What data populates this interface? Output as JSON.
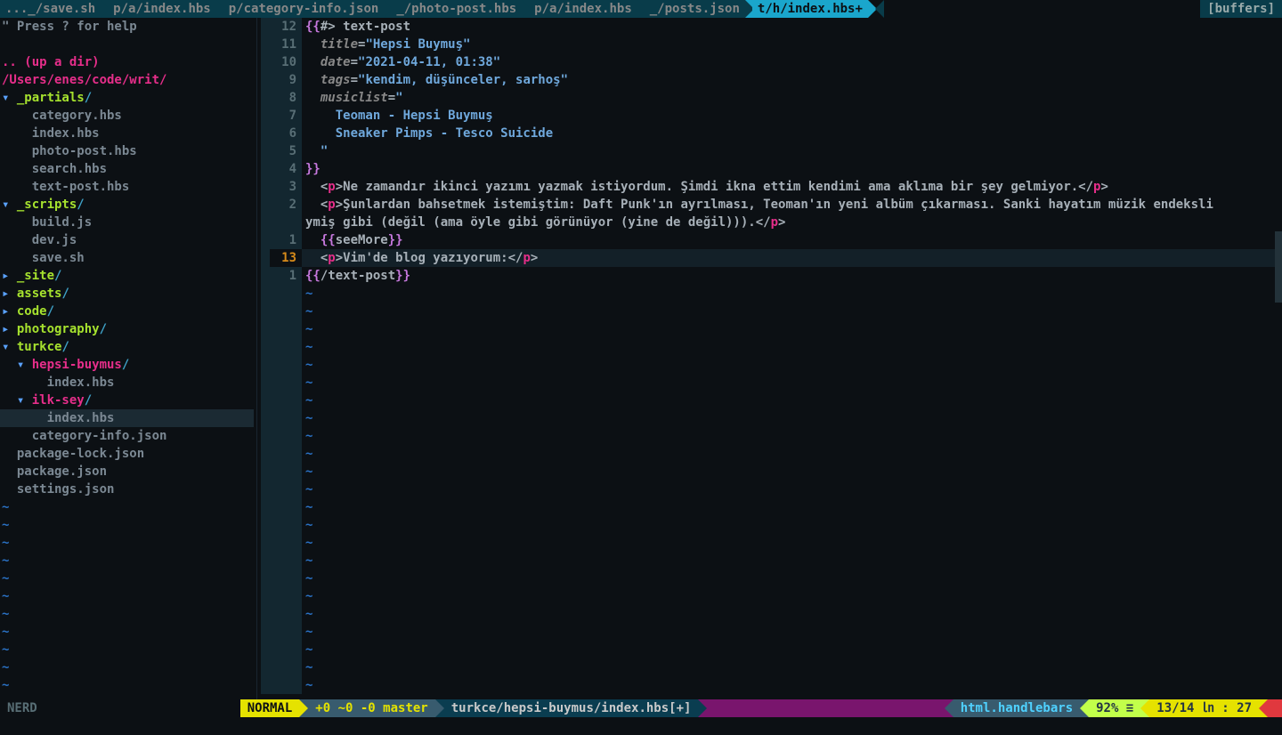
{
  "bufferline": {
    "tabs": [
      "..._/save.sh",
      "p/a/index.hbs",
      "p/category-info.json",
      "_/photo-post.hbs",
      "p/a/index.hbs",
      "_/posts.json",
      "t/h/index.hbs+"
    ],
    "active_index": 6,
    "right_label": "[buffers]"
  },
  "tree": {
    "help_line": "\" Press ? for help",
    "up_dir": ".. (up a dir)",
    "root_path": "/Users/enes/code/writ/",
    "entries": [
      {
        "indent": 0,
        "prefix": "▾ ",
        "name": "_partials",
        "type": "dir-open"
      },
      {
        "indent": 2,
        "prefix": "",
        "name": "category.hbs",
        "type": "file"
      },
      {
        "indent": 2,
        "prefix": "",
        "name": "index.hbs",
        "type": "file"
      },
      {
        "indent": 2,
        "prefix": "",
        "name": "photo-post.hbs",
        "type": "file"
      },
      {
        "indent": 2,
        "prefix": "",
        "name": "search.hbs",
        "type": "file"
      },
      {
        "indent": 2,
        "prefix": "",
        "name": "text-post.hbs",
        "type": "file"
      },
      {
        "indent": 0,
        "prefix": "▾ ",
        "name": "_scripts",
        "type": "dir-open"
      },
      {
        "indent": 2,
        "prefix": "",
        "name": "build.js",
        "type": "file"
      },
      {
        "indent": 2,
        "prefix": "",
        "name": "dev.js",
        "type": "file"
      },
      {
        "indent": 2,
        "prefix": "",
        "name": "save.sh",
        "type": "file"
      },
      {
        "indent": 0,
        "prefix": "▸ ",
        "name": "_site",
        "type": "dir-closed"
      },
      {
        "indent": 0,
        "prefix": "▸ ",
        "name": "assets",
        "type": "dir-closed"
      },
      {
        "indent": 0,
        "prefix": "▸ ",
        "name": "code",
        "type": "dir-closed"
      },
      {
        "indent": 0,
        "prefix": "▸ ",
        "name": "photography",
        "type": "dir-closed"
      },
      {
        "indent": 0,
        "prefix": "▾ ",
        "name": "turkce",
        "type": "dir-open"
      },
      {
        "indent": 1,
        "prefix": "▾ ",
        "name": "hepsi-buymus",
        "type": "dir-open-sub"
      },
      {
        "indent": 3,
        "prefix": "",
        "name": "index.hbs",
        "type": "file"
      },
      {
        "indent": 1,
        "prefix": "▾ ",
        "name": "ilk-sey",
        "type": "dir-open-sub"
      },
      {
        "indent": 3,
        "prefix": "",
        "name": "index.hbs",
        "type": "file-selected"
      },
      {
        "indent": 2,
        "prefix": "",
        "name": "category-info.json",
        "type": "file"
      },
      {
        "indent": 1,
        "prefix": "",
        "name": "package-lock.json",
        "type": "file"
      },
      {
        "indent": 1,
        "prefix": "",
        "name": "package.json",
        "type": "file"
      },
      {
        "indent": 1,
        "prefix": "",
        "name": "settings.json",
        "type": "file"
      }
    ]
  },
  "editor": {
    "current_line_label": "13",
    "lines": [
      {
        "rel": "12",
        "segments": [
          {
            "cls": "hbs",
            "t": "{{"
          },
          {
            "cls": "txt",
            "t": "#> text-post"
          }
        ]
      },
      {
        "rel": "11",
        "segments": [
          {
            "cls": "txt",
            "t": "  "
          },
          {
            "cls": "attr-name",
            "t": "title"
          },
          {
            "cls": "txt",
            "t": "="
          },
          {
            "cls": "attr-val",
            "t": "\"Hepsi Buymuş\""
          }
        ]
      },
      {
        "rel": "10",
        "segments": [
          {
            "cls": "txt",
            "t": "  "
          },
          {
            "cls": "attr-name",
            "t": "date"
          },
          {
            "cls": "txt",
            "t": "="
          },
          {
            "cls": "attr-val",
            "t": "\"2021-04-11, 01:38\""
          }
        ]
      },
      {
        "rel": "9",
        "segments": [
          {
            "cls": "txt",
            "t": "  "
          },
          {
            "cls": "attr-name",
            "t": "tags"
          },
          {
            "cls": "txt",
            "t": "="
          },
          {
            "cls": "attr-val",
            "t": "\"kendim, düşünceler, sarhoş\""
          }
        ]
      },
      {
        "rel": "8",
        "segments": [
          {
            "cls": "txt",
            "t": "  "
          },
          {
            "cls": "attr-name",
            "t": "musiclist"
          },
          {
            "cls": "txt",
            "t": "="
          },
          {
            "cls": "attr-val",
            "t": "\""
          }
        ]
      },
      {
        "rel": "7",
        "segments": [
          {
            "cls": "attr-val",
            "t": "    Teoman - Hepsi Buymuş"
          }
        ]
      },
      {
        "rel": "6",
        "segments": [
          {
            "cls": "attr-val",
            "t": "    Sneaker Pimps - Tesco Suicide"
          }
        ]
      },
      {
        "rel": "5",
        "segments": [
          {
            "cls": "attr-val",
            "t": "  \""
          }
        ]
      },
      {
        "rel": "4",
        "segments": [
          {
            "cls": "hbs",
            "t": "}}"
          }
        ]
      },
      {
        "rel": "3",
        "segments": [
          {
            "cls": "txt",
            "t": "  <"
          },
          {
            "cls": "tag-p",
            "t": "p"
          },
          {
            "cls": "txt",
            "t": ">Ne zamandır ikinci yazımı yazmak istiyordum. Şimdi ikna ettim kendimi ama aklıma bir şey gelmiyor.</"
          },
          {
            "cls": "tag-p",
            "t": "p"
          },
          {
            "cls": "txt",
            "t": ">"
          }
        ]
      },
      {
        "rel": "2",
        "segments": [
          {
            "cls": "txt",
            "t": "  <"
          },
          {
            "cls": "tag-p",
            "t": "p"
          },
          {
            "cls": "txt",
            "t": ">Şunlardan bahsetmek istemiştim: Daft Punk'ın ayrılması, Teoman'ın yeni albüm çıkarması. Sanki hayatım müzik endeksli"
          }
        ]
      },
      {
        "rel": "",
        "segments": [
          {
            "cls": "txt",
            "t": "ymiş gibi (değil (ama öyle gibi görünüyor (yine de değil))).</"
          },
          {
            "cls": "tag-p",
            "t": "p"
          },
          {
            "cls": "txt",
            "t": ">"
          }
        ]
      },
      {
        "rel": "1",
        "segments": [
          {
            "cls": "txt",
            "t": "  "
          },
          {
            "cls": "hbs",
            "t": "{{"
          },
          {
            "cls": "txt",
            "t": "seeMore"
          },
          {
            "cls": "hbs",
            "t": "}}"
          }
        ]
      },
      {
        "rel": "13",
        "current": true,
        "segments": [
          {
            "cls": "txt",
            "t": "  <"
          },
          {
            "cls": "tag-p",
            "t": "p"
          },
          {
            "cls": "txt",
            "t": ">Vim'de blog yazıyorum:</"
          },
          {
            "cls": "tag-p",
            "t": "p"
          },
          {
            "cls": "txt",
            "t": ">"
          }
        ]
      },
      {
        "rel": "1",
        "segments": [
          {
            "cls": "hbs",
            "t": "{{"
          },
          {
            "cls": "txt",
            "t": "/text-post"
          },
          {
            "cls": "hbs",
            "t": "}}"
          }
        ]
      }
    ],
    "empty_rows": 23
  },
  "statusline": {
    "left_pane": " NERD ",
    "mode": "NORMAL",
    "git": "+0 ~0 -0  master",
    "branch_icon_left": "",
    "branch_icon_right": "",
    "file": "turkce/hepsi-buymus/index.hbs[+]",
    "filetype": "html.handlebars",
    "percent": "92% ≡",
    "position": "13/14 ㏑ : 27"
  }
}
